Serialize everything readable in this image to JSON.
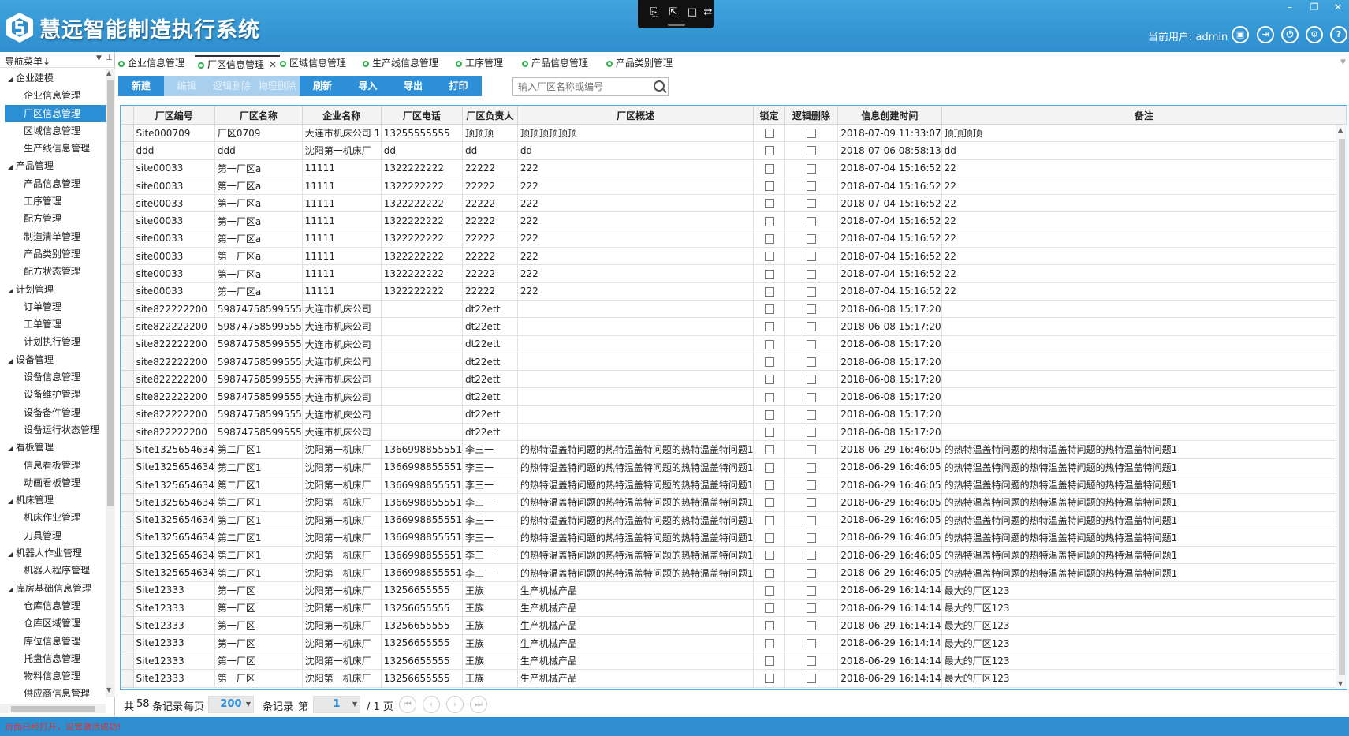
{
  "header": {
    "app_title": "慧远智能制造执行系统",
    "user_label": "当前用户: admin",
    "icons": [
      "lock-icon",
      "logout-icon",
      "power-icon",
      "gear-icon",
      "help-icon"
    ]
  },
  "sidebar": {
    "title": "导航菜单↓",
    "items": [
      {
        "label": "企业建模",
        "type": "group"
      },
      {
        "label": "企业信息管理",
        "type": "child"
      },
      {
        "label": "厂区信息管理",
        "type": "child",
        "active": true
      },
      {
        "label": "区域信息管理",
        "type": "child"
      },
      {
        "label": "生产线信息管理",
        "type": "child"
      },
      {
        "label": "产品管理",
        "type": "group"
      },
      {
        "label": "产品信息管理",
        "type": "child"
      },
      {
        "label": "工序管理",
        "type": "child"
      },
      {
        "label": "配方管理",
        "type": "child"
      },
      {
        "label": "制造清单管理",
        "type": "child"
      },
      {
        "label": "产品类别管理",
        "type": "child"
      },
      {
        "label": "配方状态管理",
        "type": "child"
      },
      {
        "label": "计划管理",
        "type": "group"
      },
      {
        "label": "订单管理",
        "type": "child"
      },
      {
        "label": "工单管理",
        "type": "child"
      },
      {
        "label": "计划执行管理",
        "type": "child"
      },
      {
        "label": "设备管理",
        "type": "group"
      },
      {
        "label": "设备信息管理",
        "type": "child"
      },
      {
        "label": "设备维护管理",
        "type": "child"
      },
      {
        "label": "设备备件管理",
        "type": "child"
      },
      {
        "label": "设备运行状态管理",
        "type": "child"
      },
      {
        "label": "看板管理",
        "type": "group"
      },
      {
        "label": "信息看板管理",
        "type": "child"
      },
      {
        "label": "动画看板管理",
        "type": "child"
      },
      {
        "label": "机床管理",
        "type": "group"
      },
      {
        "label": "机床作业管理",
        "type": "child"
      },
      {
        "label": "刀具管理",
        "type": "child"
      },
      {
        "label": "机器人作业管理",
        "type": "group"
      },
      {
        "label": "机器人程序管理",
        "type": "child"
      },
      {
        "label": "库房基础信息管理",
        "type": "group"
      },
      {
        "label": "仓库信息管理",
        "type": "child"
      },
      {
        "label": "仓库区域管理",
        "type": "child"
      },
      {
        "label": "库位信息管理",
        "type": "child"
      },
      {
        "label": "托盘信息管理",
        "type": "child"
      },
      {
        "label": "物料信息管理",
        "type": "child"
      },
      {
        "label": "供应商信息管理",
        "type": "child"
      }
    ]
  },
  "tabs": [
    {
      "label": "企业信息管理"
    },
    {
      "label": "厂区信息管理",
      "active": true
    },
    {
      "label": "区域信息管理"
    },
    {
      "label": "生产线信息管理"
    },
    {
      "label": "工序管理"
    },
    {
      "label": "产品信息管理"
    },
    {
      "label": "产品类别管理"
    }
  ],
  "toolbar": {
    "buttons": [
      {
        "label": "新建",
        "enabled": true
      },
      {
        "label": "编辑",
        "enabled": false
      },
      {
        "label": "逻辑删除",
        "enabled": false
      },
      {
        "label": "物理删除",
        "enabled": false
      },
      {
        "label": "刷新",
        "enabled": true
      },
      {
        "label": "导入",
        "enabled": true
      },
      {
        "label": "导出",
        "enabled": true
      },
      {
        "label": "打印",
        "enabled": true
      }
    ],
    "search_placeholder": "输入厂区名称或编号"
  },
  "grid": {
    "columns": [
      "厂区编号",
      "厂区名称",
      "企业名称",
      "厂区电话",
      "厂区负责人",
      "厂区概述",
      "锁定",
      "逻辑删除",
      "信息创建时间",
      "备注"
    ],
    "rows": [
      [
        "Site000709",
        "厂区0709",
        "大连市机床公司 1",
        "13255555555",
        "顶顶顶",
        "顶顶顶顶顶顶",
        "2018-07-09 11:33:07",
        "顶顶顶顶"
      ],
      [
        "ddd",
        "ddd",
        "沈阳第一机床厂",
        "dd",
        "dd",
        "dd",
        "2018-07-06 08:58:13",
        "dd"
      ],
      [
        "site00033",
        "第一厂区a",
        "11111",
        "1322222222",
        "22222",
        "222",
        "2018-07-04 15:16:52",
        "22"
      ],
      [
        "site00033",
        "第一厂区a",
        "11111",
        "1322222222",
        "22222",
        "222",
        "2018-07-04 15:16:52",
        "22"
      ],
      [
        "site00033",
        "第一厂区a",
        "11111",
        "1322222222",
        "22222",
        "222",
        "2018-07-04 15:16:52",
        "22"
      ],
      [
        "site00033",
        "第一厂区a",
        "11111",
        "1322222222",
        "22222",
        "222",
        "2018-07-04 15:16:52",
        "22"
      ],
      [
        "site00033",
        "第一厂区a",
        "11111",
        "1322222222",
        "22222",
        "222",
        "2018-07-04 15:16:52",
        "22"
      ],
      [
        "site00033",
        "第一厂区a",
        "11111",
        "1322222222",
        "22222",
        "222",
        "2018-07-04 15:16:52",
        "22"
      ],
      [
        "site00033",
        "第一厂区a",
        "11111",
        "1322222222",
        "22222",
        "222",
        "2018-07-04 15:16:52",
        "22"
      ],
      [
        "site00033",
        "第一厂区a",
        "11111",
        "1322222222",
        "22222",
        "222",
        "2018-07-04 15:16:52",
        "22"
      ],
      [
        "site822222200",
        "59874758599555",
        "大连市机床公司",
        "",
        "dt22ett",
        "",
        "2018-06-08 15:17:20",
        ""
      ],
      [
        "site822222200",
        "59874758599555",
        "大连市机床公司",
        "",
        "dt22ett",
        "",
        "2018-06-08 15:17:20",
        ""
      ],
      [
        "site822222200",
        "59874758599555",
        "大连市机床公司",
        "",
        "dt22ett",
        "",
        "2018-06-08 15:17:20",
        ""
      ],
      [
        "site822222200",
        "59874758599555",
        "大连市机床公司",
        "",
        "dt22ett",
        "",
        "2018-06-08 15:17:20",
        ""
      ],
      [
        "site822222200",
        "59874758599555",
        "大连市机床公司",
        "",
        "dt22ett",
        "",
        "2018-06-08 15:17:20",
        ""
      ],
      [
        "site822222200",
        "59874758599555",
        "大连市机床公司",
        "",
        "dt22ett",
        "",
        "2018-06-08 15:17:20",
        ""
      ],
      [
        "site822222200",
        "59874758599555",
        "大连市机床公司",
        "",
        "dt22ett",
        "",
        "2018-06-08 15:17:20",
        ""
      ],
      [
        "site822222200",
        "59874758599555",
        "大连市机床公司",
        "",
        "dt22ett",
        "",
        "2018-06-08 15:17:20",
        ""
      ],
      [
        "Site1325654634",
        "第二厂区1",
        "沈阳第一机床厂",
        "1366998855551",
        "李三一",
        "的热特温盖特问题的热特温盖特问题的热特温盖特问题1",
        "2018-06-29 16:46:05",
        "的热特温盖特问题的热特温盖特问题的热特温盖特问题1"
      ],
      [
        "Site1325654634",
        "第二厂区1",
        "沈阳第一机床厂",
        "1366998855551",
        "李三一",
        "的热特温盖特问题的热特温盖特问题的热特温盖特问题1",
        "2018-06-29 16:46:05",
        "的热特温盖特问题的热特温盖特问题的热特温盖特问题1"
      ],
      [
        "Site1325654634",
        "第二厂区1",
        "沈阳第一机床厂",
        "1366998855551",
        "李三一",
        "的热特温盖特问题的热特温盖特问题的热特温盖特问题1",
        "2018-06-29 16:46:05",
        "的热特温盖特问题的热特温盖特问题的热特温盖特问题1"
      ],
      [
        "Site1325654634",
        "第二厂区1",
        "沈阳第一机床厂",
        "1366998855551",
        "李三一",
        "的热特温盖特问题的热特温盖特问题的热特温盖特问题1",
        "2018-06-29 16:46:05",
        "的热特温盖特问题的热特温盖特问题的热特温盖特问题1"
      ],
      [
        "Site1325654634",
        "第二厂区1",
        "沈阳第一机床厂",
        "1366998855551",
        "李三一",
        "的热特温盖特问题的热特温盖特问题的热特温盖特问题1",
        "2018-06-29 16:46:05",
        "的热特温盖特问题的热特温盖特问题的热特温盖特问题1"
      ],
      [
        "Site1325654634",
        "第二厂区1",
        "沈阳第一机床厂",
        "1366998855551",
        "李三一",
        "的热特温盖特问题的热特温盖特问题的热特温盖特问题1",
        "2018-06-29 16:46:05",
        "的热特温盖特问题的热特温盖特问题的热特温盖特问题1"
      ],
      [
        "Site1325654634",
        "第二厂区1",
        "沈阳第一机床厂",
        "1366998855551",
        "李三一",
        "的热特温盖特问题的热特温盖特问题的热特温盖特问题1",
        "2018-06-29 16:46:05",
        "的热特温盖特问题的热特温盖特问题的热特温盖特问题1"
      ],
      [
        "Site1325654634",
        "第二厂区1",
        "沈阳第一机床厂",
        "1366998855551",
        "李三一",
        "的热特温盖特问题的热特温盖特问题的热特温盖特问题1",
        "2018-06-29 16:46:05",
        "的热特温盖特问题的热特温盖特问题的热特温盖特问题1"
      ],
      [
        "Site12333",
        "第一厂区",
        "沈阳第一机床厂",
        "13256655555",
        "王族",
        "生产机械产品",
        "2018-06-29 16:14:14",
        "最大的厂区123"
      ],
      [
        "Site12333",
        "第一厂区",
        "沈阳第一机床厂",
        "13256655555",
        "王族",
        "生产机械产品",
        "2018-06-29 16:14:14",
        "最大的厂区123"
      ],
      [
        "Site12333",
        "第一厂区",
        "沈阳第一机床厂",
        "13256655555",
        "王族",
        "生产机械产品",
        "2018-06-29 16:14:14",
        "最大的厂区123"
      ],
      [
        "Site12333",
        "第一厂区",
        "沈阳第一机床厂",
        "13256655555",
        "王族",
        "生产机械产品",
        "2018-06-29 16:14:14",
        "最大的厂区123"
      ],
      [
        "Site12333",
        "第一厂区",
        "沈阳第一机床厂",
        "13256655555",
        "王族",
        "生产机械产品",
        "2018-06-29 16:14:14",
        "最大的厂区123"
      ],
      [
        "Site12333",
        "第一厂区",
        "沈阳第一机床厂",
        "13256655555",
        "王族",
        "生产机械产品",
        "2018-06-29 16:14:14",
        "最大的厂区123"
      ]
    ]
  },
  "pager": {
    "total_prefix": "共",
    "total_count": "58",
    "total_suffix": "条记录",
    "per_page_label": "每页",
    "page_size": "200",
    "records_page_label": "条记录",
    "page_prefix": "第",
    "current_page": "1",
    "page_total": "/ 1 页"
  },
  "status": {
    "message": "页面已经打开，设置激活成功!"
  }
}
